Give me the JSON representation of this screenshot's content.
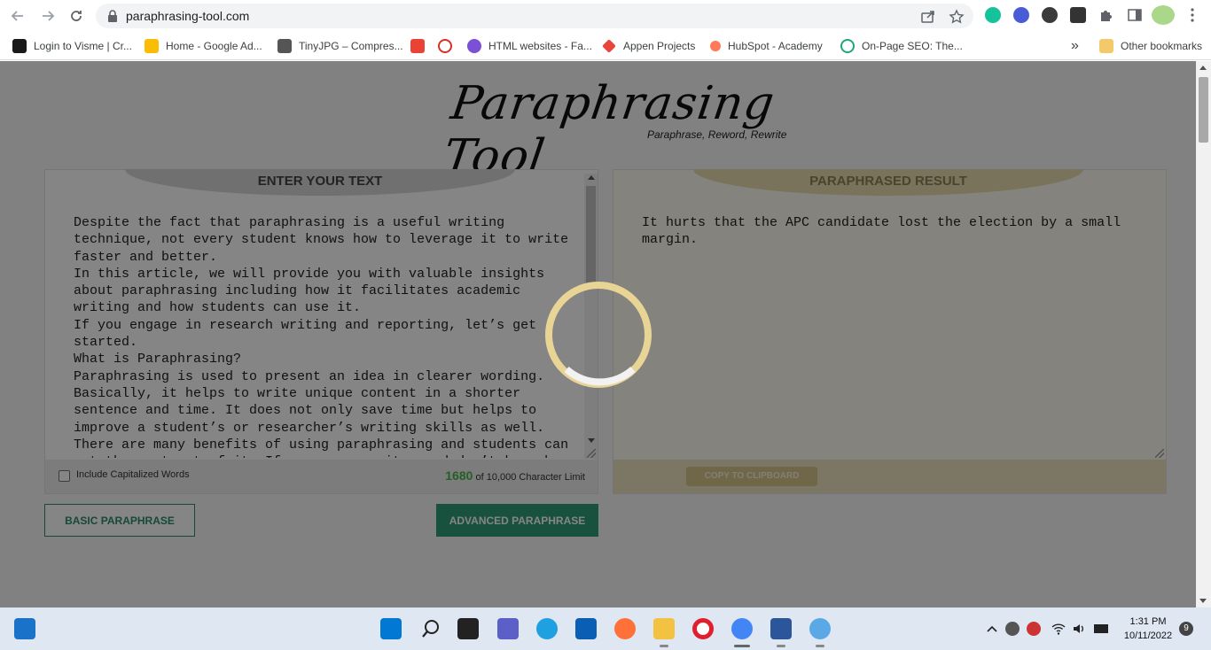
{
  "browser": {
    "url": "paraphrasing-tool.com",
    "bookmarks": [
      {
        "label": "Login to Visme | Cr...",
        "icon": "visme-icon",
        "color": "#1a1a1a"
      },
      {
        "label": "Home - Google Ad...",
        "icon": "google-ads-icon",
        "color": "#fbbc04"
      },
      {
        "label": "TinyJPG – Compres...",
        "icon": "panda-icon",
        "color": "#333333"
      },
      {
        "label": "",
        "icon": "gmail-icon",
        "color": "#ea4335"
      },
      {
        "label": "",
        "icon": "t-circle-icon",
        "color": "#d93025"
      },
      {
        "label": "HTML websites - Fa...",
        "icon": "c-circle-icon",
        "color": "#7b4fd6"
      },
      {
        "label": "Appen Projects",
        "icon": "appen-icon",
        "color": "#e8453c"
      },
      {
        "label": "HubSpot - Academy",
        "icon": "hubspot-icon",
        "color": "#ff7a59"
      },
      {
        "label": "On-Page SEO: The...",
        "icon": "ring-icon",
        "color": "#1fa67a"
      }
    ],
    "overflow_label": "»",
    "other_bookmarks": "Other bookmarks"
  },
  "page": {
    "logo_title": "Paraphrasing Tool",
    "logo_subtitle": "Paraphrase, Reword, Rewrite",
    "input_panel": {
      "title": "ENTER YOUR TEXT",
      "text": "Despite the fact that paraphrasing is a useful writing\ntechnique, not every student knows how to leverage it to write\nfaster and better.\nIn this article, we will provide you with valuable insights\nabout paraphrasing including how it facilitates academic\nwriting and how students can use it.\nIf you engage in research writing and reporting, let’s get\nstarted.\nWhat is Paraphrasing?\nParaphrasing is used to present an idea in clearer wording.\nBasically, it helps to write unique content in a shorter\nsentence and time. It does not only save time but helps to\nimprove a student’s or researcher’s writing skills as well.\nThere are many benefits of using paraphrasing and students can\nget the most out of it. If you are a writer and don’t know how",
      "checkbox_label": "Include Capitalized Words",
      "char_count": "1680",
      "char_limit_text": "of 10,000 Character Limit"
    },
    "result_panel": {
      "title": "PARAPHRASED RESULT",
      "text": "It hurts that the APC candidate lost the election by a small\nmargin.",
      "copy_label": "COPY TO CLIPBOARD"
    },
    "buttons": {
      "basic": "BASIC PARAPHRASE",
      "advanced": "ADVANCED PARAPHRASE"
    }
  },
  "taskbar": {
    "time": "1:31 PM",
    "date": "10/11/2022",
    "notifications": "9"
  }
}
